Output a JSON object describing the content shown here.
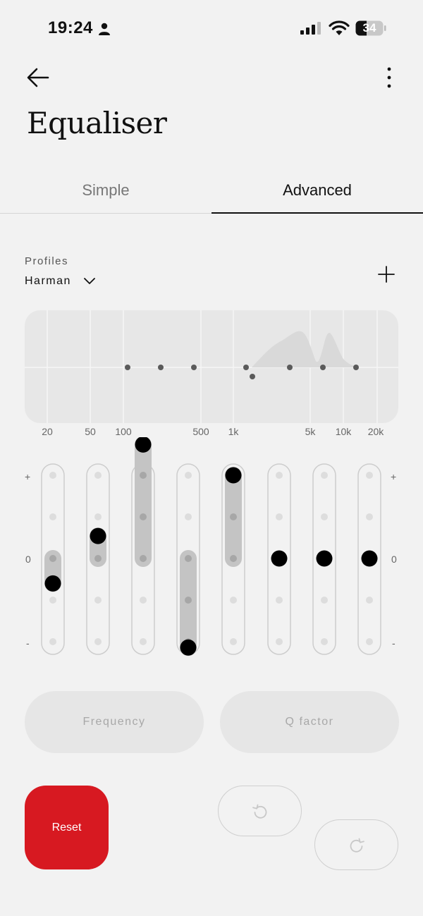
{
  "status": {
    "time": "19:24",
    "battery": "34"
  },
  "header": {
    "title": "Equaliser"
  },
  "tabs": [
    {
      "label": "Simple",
      "selected": false
    },
    {
      "label": "Advanced",
      "selected": true
    }
  ],
  "profiles": {
    "label": "Profiles",
    "current": "Harman"
  },
  "frequency_axis": [
    "20",
    "50",
    "100",
    "500",
    "1k",
    "5k",
    "10k",
    "20k"
  ],
  "scale": {
    "plus": "+",
    "zero": "0",
    "minus": "-"
  },
  "bands": [
    {
      "level": -0.3
    },
    {
      "level": 0.27
    },
    {
      "level": 1.37
    },
    {
      "level": -1.07
    },
    {
      "level": 1.0
    },
    {
      "level": 0
    },
    {
      "level": 0
    },
    {
      "level": 0
    }
  ],
  "params": {
    "frequency": "Frequency",
    "q_factor": "Q factor"
  },
  "actions": {
    "reset": "Reset"
  },
  "colors": {
    "accent": "#d71921",
    "background": "#f2f2f2",
    "knob": "#000000",
    "track_fill": "#c4c4c4"
  }
}
